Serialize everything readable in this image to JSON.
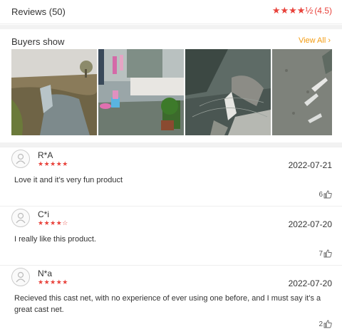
{
  "header": {
    "title": "Reviews (50)",
    "stars": "★★★★½",
    "score": "(4.5)"
  },
  "buyers": {
    "title": "Buyers show",
    "view_all": "View All ›",
    "photos": [
      "field-pond-photo",
      "courtyard-water-photo",
      "cast-net-water-photo",
      "fish-on-ground-photo"
    ]
  },
  "reviews": [
    {
      "name": "R*A",
      "stars": "★★★★★",
      "rating": 5,
      "date": "2022-07-21",
      "text": "Love it and it’s very fun product",
      "likes": "6"
    },
    {
      "name": "C*i",
      "stars": "★★★★☆",
      "rating": 4,
      "date": "2022-07-20",
      "text": "I really like this product.",
      "likes": "7"
    },
    {
      "name": "N*a",
      "stars": "★★★★★",
      "rating": 5,
      "date": "2022-07-20",
      "text": "Recieved this cast net, with no experience of ever using one before, and I must say it's a great cast net.",
      "likes": "2"
    }
  ],
  "colors": {
    "accent": "#e8423b",
    "link": "#f39c12"
  }
}
